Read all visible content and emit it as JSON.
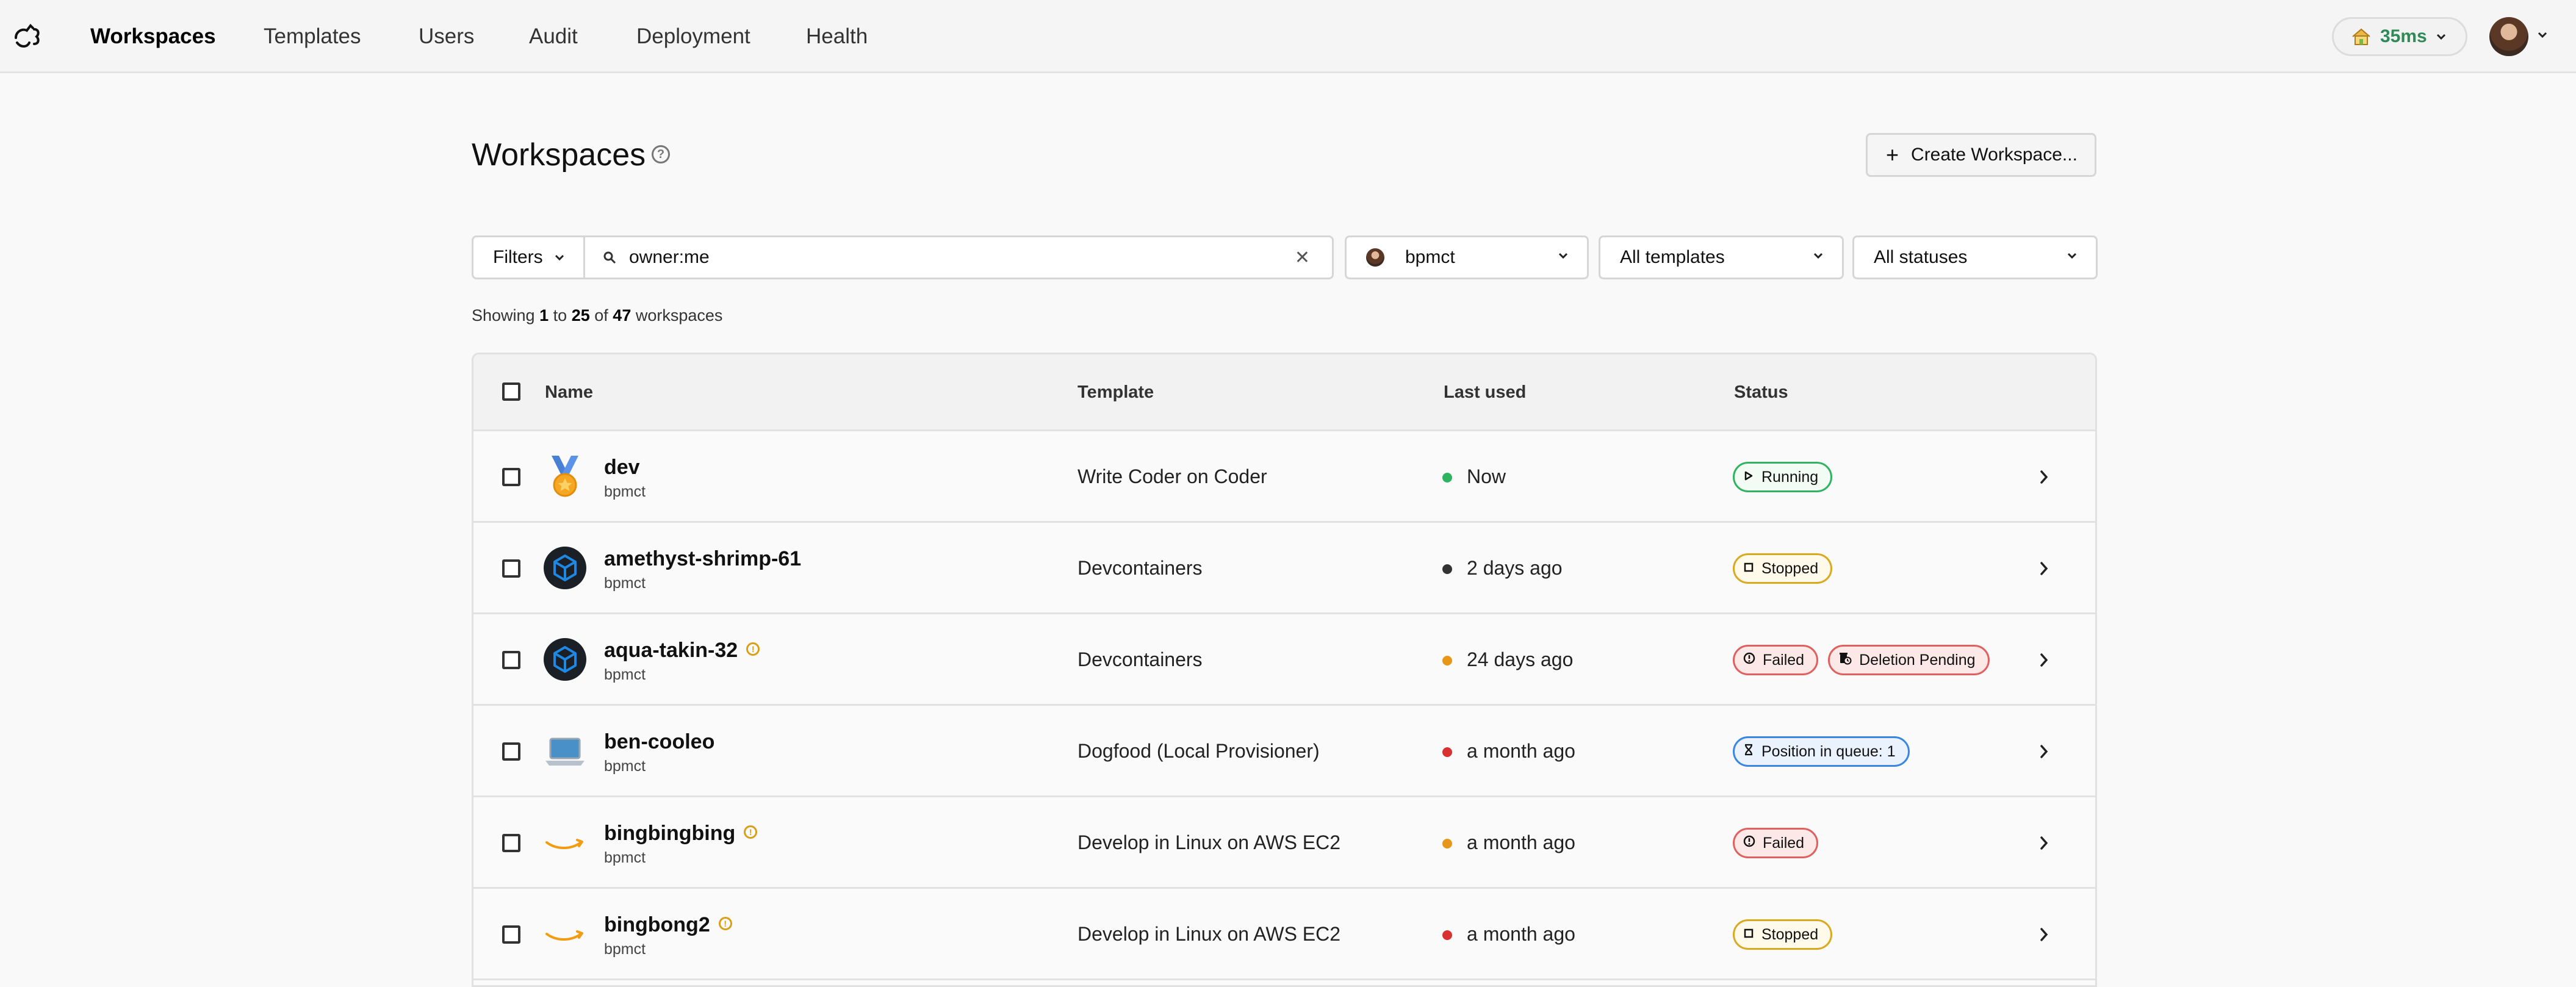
{
  "nav": {
    "items": [
      {
        "label": "Workspaces",
        "active": true
      },
      {
        "label": "Templates",
        "active": false
      },
      {
        "label": "Users",
        "active": false
      },
      {
        "label": "Audit",
        "active": false
      },
      {
        "label": "Deployment",
        "active": false
      },
      {
        "label": "Health",
        "active": false
      }
    ],
    "latency": "35ms"
  },
  "page": {
    "title": "Workspaces",
    "help_glyph": "?",
    "create_button": "Create Workspace..."
  },
  "filters": {
    "filters_label": "Filters",
    "search_value": "owner:me",
    "owner_select": "bpmct",
    "template_select": "All templates",
    "status_select": "All statuses"
  },
  "showing": {
    "prefix": "Showing",
    "from": "1",
    "to_word": "to",
    "to": "25",
    "of_word": "of",
    "total": "47",
    "suffix": "workspaces"
  },
  "table": {
    "headers": {
      "name": "Name",
      "template": "Template",
      "last_used": "Last used",
      "status": "Status"
    },
    "rows": [
      {
        "name": "dev",
        "owner": "bpmct",
        "icon": "medal-icon",
        "warning": false,
        "template": "Write Coder on Coder",
        "last_used": "Now",
        "dot_color": "#2fb360",
        "badges": [
          {
            "label": "Running",
            "kind": "running",
            "icon": "play-icon"
          }
        ]
      },
      {
        "name": "amethyst-shrimp-61",
        "owner": "bpmct",
        "icon": "devcontainer-cube-icon",
        "warning": false,
        "template": "Devcontainers",
        "last_used": "2 days ago",
        "dot_color": "#333333",
        "badges": [
          {
            "label": "Stopped",
            "kind": "stopped",
            "icon": "stop-icon"
          }
        ]
      },
      {
        "name": "aqua-takin-32",
        "owner": "bpmct",
        "icon": "devcontainer-cube-icon",
        "warning": true,
        "template": "Devcontainers",
        "last_used": "24 days ago",
        "dot_color": "#e8961a",
        "badges": [
          {
            "label": "Failed",
            "kind": "failed",
            "icon": "error-circle-icon"
          },
          {
            "label": "Deletion Pending",
            "kind": "pending",
            "icon": "trash-clock-icon"
          }
        ]
      },
      {
        "name": "ben-cooleo",
        "owner": "bpmct",
        "icon": "laptop-icon",
        "warning": false,
        "template": "Dogfood (Local Provisioner)",
        "last_used": "a month ago",
        "dot_color": "#d93030",
        "badges": [
          {
            "label": "Position in queue: 1",
            "kind": "queue",
            "icon": "hourglass-icon"
          }
        ]
      },
      {
        "name": "bingbingbing",
        "owner": "bpmct",
        "icon": "aws-smile-icon",
        "warning": true,
        "template": "Develop in Linux on AWS EC2",
        "last_used": "a month ago",
        "dot_color": "#e8961a",
        "badges": [
          {
            "label": "Failed",
            "kind": "failed",
            "icon": "error-circle-icon"
          }
        ]
      },
      {
        "name": "bingbong2",
        "owner": "bpmct",
        "icon": "aws-smile-icon",
        "warning": true,
        "template": "Develop in Linux on AWS EC2",
        "last_used": "a month ago",
        "dot_color": "#d93030",
        "badges": [
          {
            "label": "Stopped",
            "kind": "stopped",
            "icon": "stop-icon"
          }
        ]
      }
    ]
  }
}
